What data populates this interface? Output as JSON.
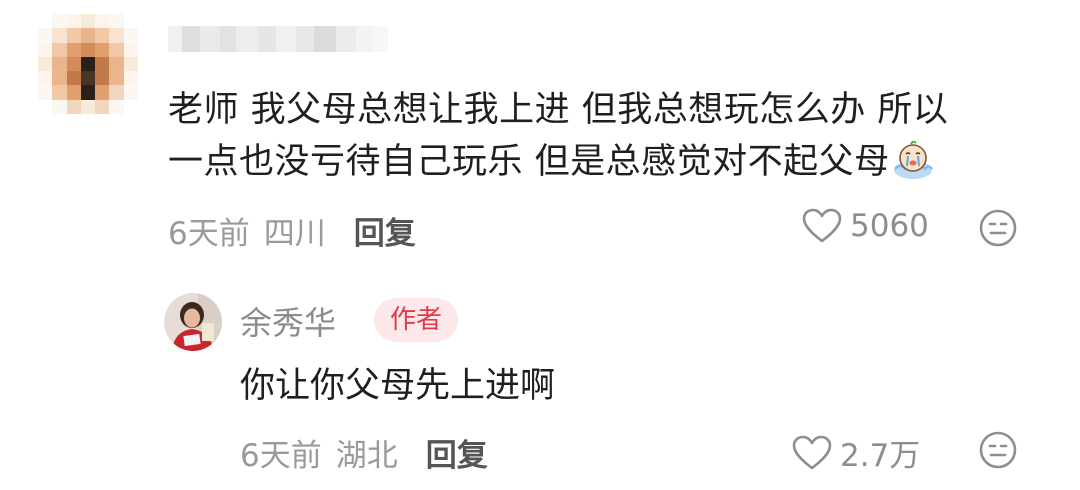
{
  "comment": {
    "text_lines": [
      "老师 我父母总想让我上进 但我总想玩怎么办 所以",
      "一点也没亏待自己玩乐 但是总感觉对不起父母"
    ],
    "emoji": "crying-face-icon",
    "time": "6天前",
    "location": "四川",
    "reply_label": "回复",
    "like_count": "5060"
  },
  "reply": {
    "author_name": "余秀华",
    "author_badge": "作者",
    "text": "你让你父母先上进啊",
    "time": "6天前",
    "location": "湖北",
    "reply_label": "回复",
    "like_count": "2.7万"
  },
  "colors": {
    "text_primary": "#1f1f1f",
    "text_meta": "#9a9a9a",
    "badge_bg": "#fde8ea",
    "badge_text": "#e5394a",
    "icon_gray": "#8e8e8e"
  }
}
